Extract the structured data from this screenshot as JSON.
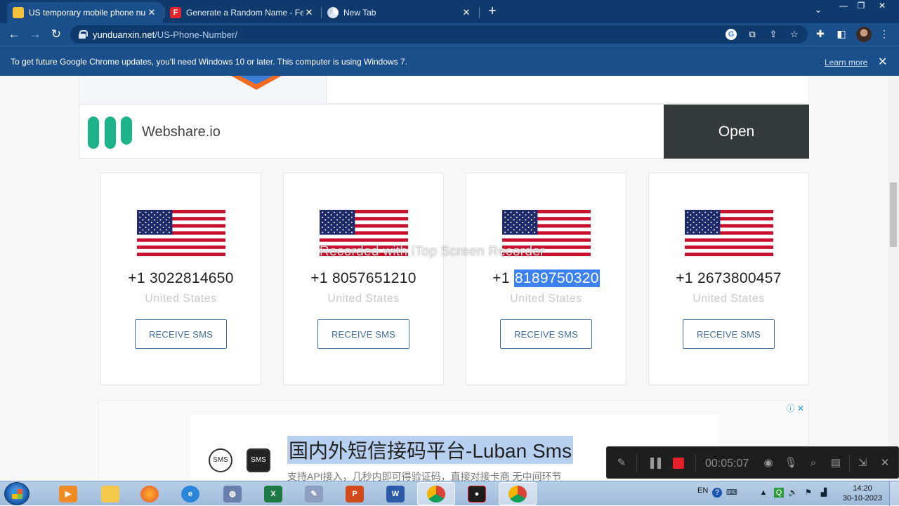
{
  "browser": {
    "tabs": [
      {
        "title": "US temporary mobile phone num",
        "favicon": "yellow-square-icon",
        "active": true
      },
      {
        "title": "Generate a Random Name - Fem",
        "favicon": "f-letter-icon",
        "active": false
      },
      {
        "title": "New Tab",
        "favicon": "chrome-icon",
        "active": false
      }
    ],
    "url_host": "yunduanxin.net",
    "url_path": "/US-Phone-Number/",
    "infobar_text": "To get future Google Chrome updates, you'll need Windows 10 or later. This computer is using Windows 7.",
    "infobar_link": "Learn more"
  },
  "ads": {
    "webshare_name": "Webshare.io",
    "webshare_button": "Open",
    "luban_title": "国内外短信接码平台-Luban Sms",
    "luban_sub": "支持API接入，几秒内即可得验证码，直接对接卡商 无中间环节",
    "sms_icon_label": "SMS"
  },
  "numbers": [
    {
      "prefix": "+1 ",
      "number": "3022814650",
      "country": "United States",
      "button": "RECEIVE SMS",
      "highlighted": false
    },
    {
      "prefix": "+1 ",
      "number": "8057651210",
      "country": "United States",
      "button": "RECEIVE SMS",
      "highlighted": false
    },
    {
      "prefix": "+1 ",
      "number": "8189750320",
      "country": "United States",
      "button": "RECEIVE SMS",
      "highlighted": true
    },
    {
      "prefix": "+1 ",
      "number": "2673800457",
      "country": "United States",
      "button": "RECEIVE SMS",
      "highlighted": false
    }
  ],
  "watermark": "Recorded with iTop Screen Recorder",
  "recorder": {
    "time": "00:05:07"
  },
  "taskbar": {
    "language": "EN",
    "time": "14:20",
    "date": "30-10-2023"
  },
  "colors": {
    "chrome_dark": "#0e3a6e",
    "chrome": "#1b4f8c",
    "button_border": "#3f6e9a",
    "highlight": "#3b82f0",
    "webshare_green": "#1fb38a",
    "record_red": "#e5202b"
  }
}
